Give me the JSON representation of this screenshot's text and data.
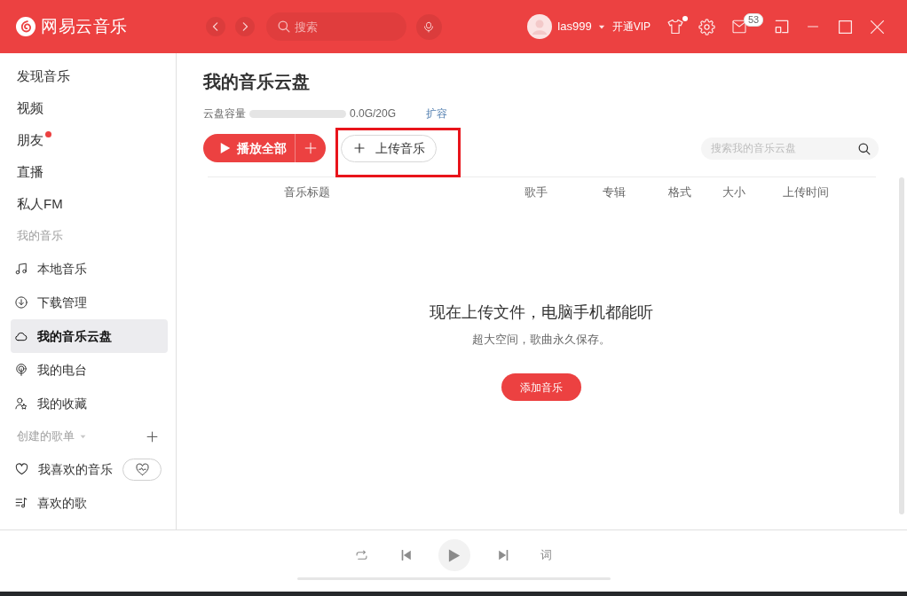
{
  "header": {
    "app_name": "网易云音乐",
    "search": {
      "placeholder": "搜索"
    },
    "user": {
      "name": "las999"
    },
    "vip_link": "开通VIP",
    "skin": {
      "dot": true
    },
    "messages": {
      "count": "53"
    }
  },
  "sidebar": {
    "items": [
      {
        "label": "发现音乐",
        "selected": false,
        "dot": false
      },
      {
        "label": "视频",
        "selected": false,
        "dot": false
      },
      {
        "label": "朋友",
        "selected": false,
        "dot": true
      },
      {
        "label": "直播",
        "selected": false,
        "dot": false
      },
      {
        "label": "私人FM",
        "selected": false,
        "dot": false
      }
    ],
    "groups": [
      {
        "kind": "library",
        "title": "我的音乐",
        "items": [
          {
            "label": "本地音乐",
            "selected": false
          },
          {
            "label": "下载管理",
            "selected": false
          },
          {
            "label": "我的音乐云盘",
            "selected": true
          },
          {
            "label": "我的电台",
            "selected": false
          },
          {
            "label": "我的收藏",
            "selected": false
          }
        ]
      },
      {
        "kind": "playlists",
        "title": "创建的歌单",
        "items": [
          {
            "kind": "liked",
            "label": "我喜欢的音乐",
            "selected": false
          },
          {
            "kind": "playlist",
            "label": "喜欢的歌",
            "selected": false
          }
        ]
      }
    ]
  },
  "cloud": {
    "title": "我的音乐云盘",
    "capacity": {
      "label": "云盘容量",
      "level": 0,
      "reading": "0.0G/20G",
      "expand_link": "扩容"
    },
    "play_all": "播放全部",
    "upload": {
      "label": "上传音乐",
      "highlighted": true
    },
    "search": {
      "placeholder": "搜索我的音乐云盘"
    },
    "table": {
      "columns": [
        "音乐标题",
        "歌手",
        "专辑",
        "格式",
        "大小",
        "上传时间"
      ]
    },
    "empty_state": {
      "title": "现在上传文件，电脑手机都能听",
      "subtitle": "超大空间，歌曲永久保存。",
      "button": "添加音乐"
    }
  },
  "player": {
    "playing": false,
    "lyrics_button": "词",
    "progress": {
      "level": 0
    }
  }
}
